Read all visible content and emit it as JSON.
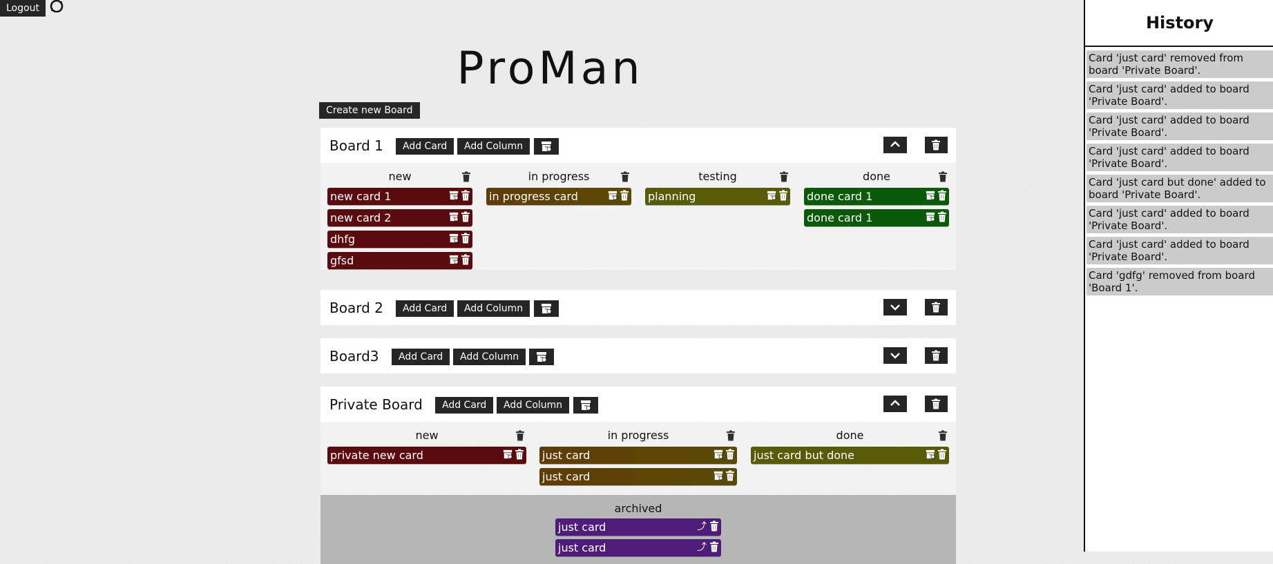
{
  "header": {
    "logout_label": "Logout",
    "title": "ProMan",
    "create_board_label": "Create new Board"
  },
  "icons": {
    "refresh": "refresh-icon",
    "archive": "archive-icon",
    "trash": "trash-icon",
    "chevron_up": "chevron-up-icon",
    "chevron_down": "chevron-down-icon",
    "unarchive": "unarchive-icon"
  },
  "boards": [
    {
      "title": "Board 1",
      "add_card_label": "Add Card",
      "add_column_label": "Add Column",
      "expanded": true,
      "columns": [
        {
          "title": "new",
          "cards": [
            "new card 1",
            "new card 2",
            "dhfg",
            "gfsd"
          ]
        },
        {
          "title": "in progress",
          "cards": [
            "in progress card"
          ]
        },
        {
          "title": "testing",
          "cards": [
            "planning"
          ]
        },
        {
          "title": "done",
          "cards": [
            "done card 1",
            "done card 1"
          ]
        }
      ]
    },
    {
      "title": "Board 2",
      "add_card_label": "Add Card",
      "add_column_label": "Add Column",
      "expanded": false
    },
    {
      "title": "Board3",
      "add_card_label": "Add Card",
      "add_column_label": "Add Column",
      "expanded": false
    },
    {
      "title": "Private Board",
      "add_card_label": "Add Card",
      "add_column_label": "Add Column",
      "expanded": true,
      "columns": [
        {
          "title": "new",
          "cards": [
            "private new card"
          ]
        },
        {
          "title": "in progress",
          "cards": [
            "just card",
            "just card"
          ]
        },
        {
          "title": "done",
          "cards": [
            "just card but done"
          ]
        }
      ],
      "archived": {
        "title": "archived",
        "cards": [
          "just card",
          "just card"
        ]
      }
    }
  ],
  "history": {
    "title": "History",
    "items": [
      "Card 'just card' removed from board 'Private Board'.",
      "Card 'just card' added to board 'Private Board'.",
      "Card 'just card' added to board 'Private Board'.",
      "Card 'just card' added to board 'Private Board'.",
      "Card 'just card but done' added to board 'Private Board'.",
      "Card 'just card' added to board 'Private Board'.",
      "Card 'just card' added to board 'Private Board'.",
      "Card 'gdfg' removed from board 'Board 1'."
    ]
  },
  "colors": {
    "new": "#5b0a0e",
    "in_progress": "#5e3c06",
    "testing": "#575a07",
    "done_board1": "#0a5a0a",
    "done_private": "#575a07",
    "archived": "#4e1d7a"
  }
}
